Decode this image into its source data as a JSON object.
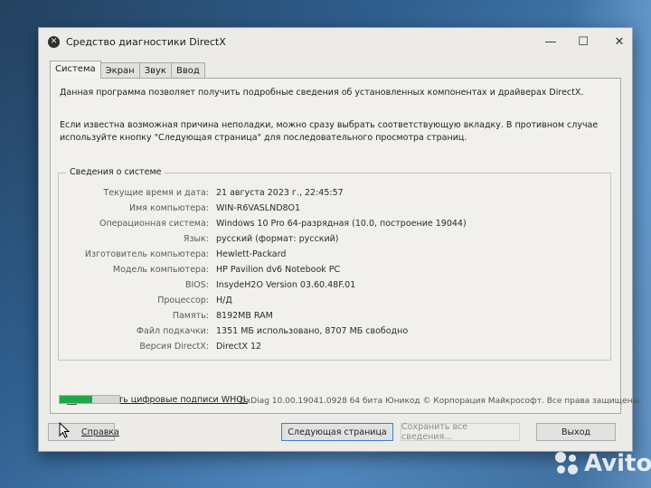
{
  "window": {
    "title": "Средство диагностики DirectX",
    "controls": {
      "minimize": "—",
      "maximize": "☐",
      "close": "✕"
    }
  },
  "tabs": [
    {
      "label": "Система",
      "active": true
    },
    {
      "label": "Экран",
      "active": false
    },
    {
      "label": "Звук",
      "active": false
    },
    {
      "label": "Ввод",
      "active": false
    }
  ],
  "intro_text": "Данная программа позволяет получить подробные сведения об установленных компонентах и драйверах DirectX.",
  "hint_text": "Если известна возможная причина неполадки, можно сразу выбрать соответствующую вкладку. В противном случае используйте кнопку \"Следующая страница\" для последовательного просмотра страниц.",
  "system_info": {
    "title": "Сведения о системе",
    "rows": [
      {
        "label": "Текущие время и дата:",
        "value": "21 августа 2023 г., 22:45:57"
      },
      {
        "label": "Имя компьютера:",
        "value": "WIN-R6VASLND8O1"
      },
      {
        "label": "Операционная система:",
        "value": "Windows 10 Pro 64-разрядная (10.0, построение 19044)"
      },
      {
        "label": "Язык:",
        "value": "русский (формат: русский)"
      },
      {
        "label": "Изготовитель компьютера:",
        "value": "Hewlett-Packard"
      },
      {
        "label": "Модель компьютера:",
        "value": "HP Pavilion dv6 Notebook PC"
      },
      {
        "label": "BIOS:",
        "value": "InsydeH2O Version 03.60.48F.01"
      },
      {
        "label": "Процессор:",
        "value": "Н/Д"
      },
      {
        "label": "Память:",
        "value": "8192MB RAM"
      },
      {
        "label": "Файл подкачки:",
        "value": "1351 МБ использовано, 8707 МБ свободно"
      },
      {
        "label": "Версия DirectX:",
        "value": "DirectX 12"
      }
    ]
  },
  "whql_checkbox": {
    "label": "Проверить цифровые подписи WHQL",
    "checked": true
  },
  "progress_fraction": 0.55,
  "copyright": "DxDiag 10.00.19041.0928 64 бита Юникод © Корпорация Майкрософт. Все права защищены.",
  "buttons": {
    "help": "Справка",
    "next": "Следующая страница",
    "save_all": "Сохранить все сведения...",
    "exit": "Выход"
  },
  "watermark": "Avito",
  "colors": {
    "progress": "#1ea84a",
    "focus_border": "#3c7fd0"
  }
}
